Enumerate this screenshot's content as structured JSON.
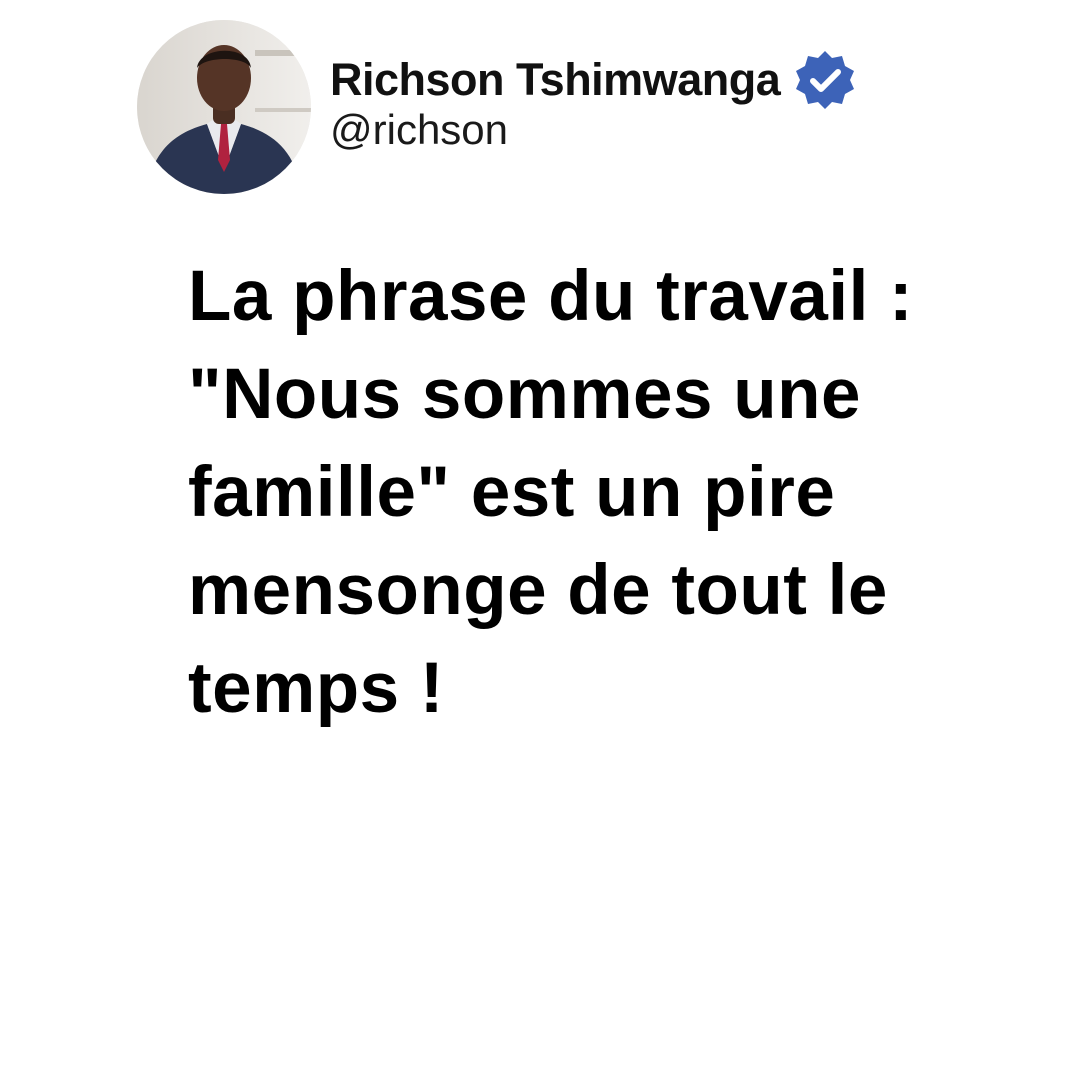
{
  "author": {
    "name": "Richson Tshimwanga",
    "handle": "@richson",
    "verified_icon": "verified-badge-icon",
    "badge_color": "#3d63b8"
  },
  "post": {
    "lines": [
      "La phrase du travail :",
      "\"Nous sommes une",
      "famille\" est un pire",
      "mensonge de tout le",
      "temps !"
    ]
  }
}
